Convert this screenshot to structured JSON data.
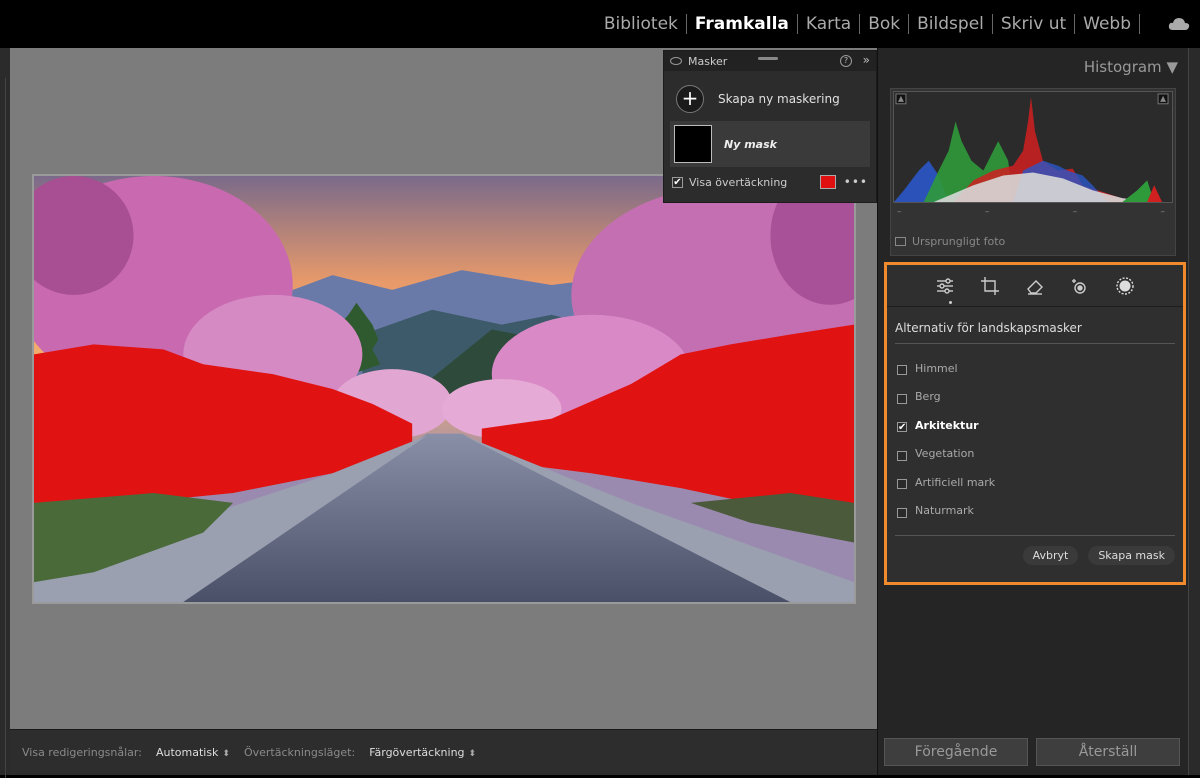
{
  "nav": {
    "items": [
      "Bibliotek",
      "Framkalla",
      "Karta",
      "Bok",
      "Bildspel",
      "Skriv ut",
      "Webb"
    ],
    "active": "Framkalla"
  },
  "masks_panel": {
    "title": "Masker",
    "create_label": "Skapa ny maskering",
    "mask_name": "Ny mask",
    "show_overlay_label": "Visa övertäckning",
    "show_overlay_checked": true,
    "overlay_color": "#e01010"
  },
  "toolbar": {
    "pins_label": "Visa redigeringsnålar:",
    "pins_value": "Automatisk",
    "overlay_mode_label": "Övertäckningsläget:",
    "overlay_mode_value": "Färgövertäckning"
  },
  "histogram": {
    "title": "Histogram",
    "ticks": [
      "–",
      "–",
      "–",
      "–"
    ],
    "original_photo_label": "Ursprungligt foto"
  },
  "landscape_masks": {
    "title": "Alternativ för landskapsmasker",
    "options": [
      {
        "label": "Himmel",
        "checked": false
      },
      {
        "label": "Berg",
        "checked": false
      },
      {
        "label": "Arkitektur",
        "checked": true
      },
      {
        "label": "Vegetation",
        "checked": false
      },
      {
        "label": "Artificiell mark",
        "checked": false
      },
      {
        "label": "Naturmark",
        "checked": false
      }
    ],
    "cancel_label": "Avbryt",
    "create_label": "Skapa mask",
    "highlight_color": "#f08a2c"
  },
  "footer": {
    "previous_label": "Föregående",
    "reset_label": "Återställ"
  }
}
